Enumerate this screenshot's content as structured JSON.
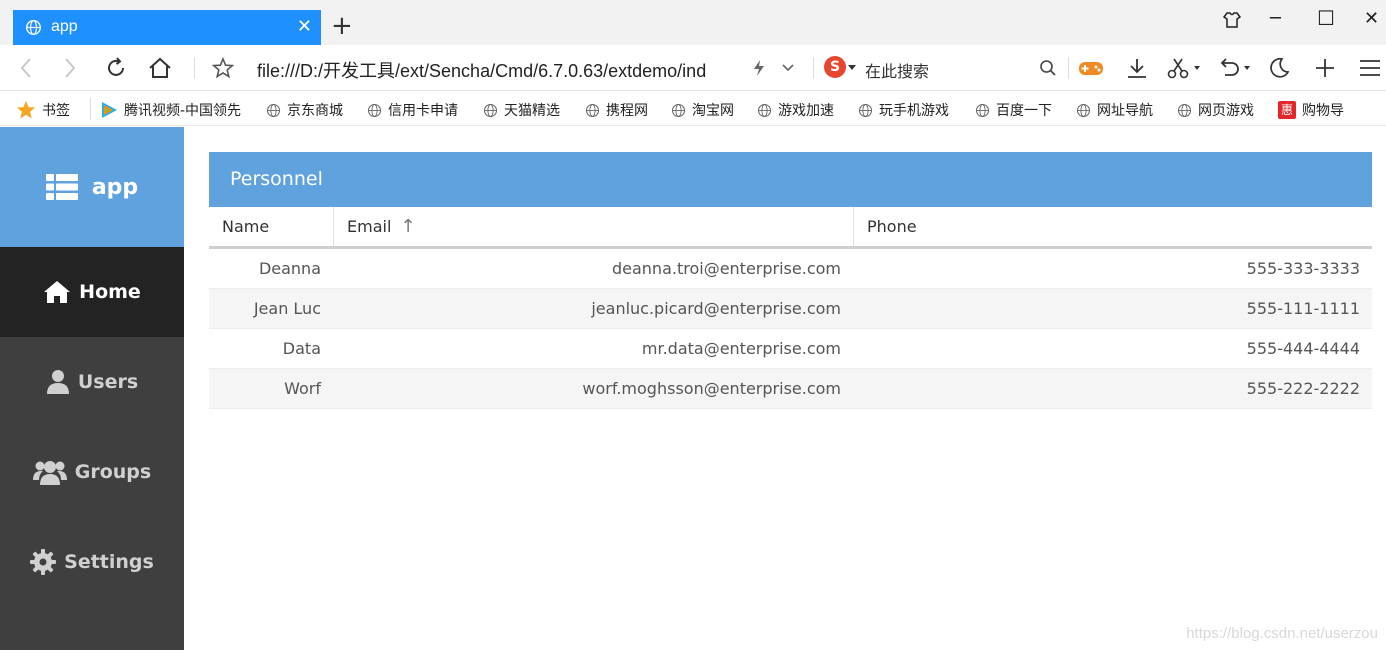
{
  "browser": {
    "tab": {
      "title": "app",
      "close_label": "✕"
    },
    "new_tab_label": "+",
    "window_controls": {
      "skin": "skin-icon",
      "minimize": "─",
      "maximize": "☐",
      "close": "✕"
    },
    "address": {
      "url": "file:///D:/开发工具/ext/Sencha/Cmd/6.7.0.63/extdemo/ind"
    },
    "search": {
      "placeholder": "在此搜索"
    },
    "bookmarks": [
      {
        "label": "书签",
        "icon": "star-icon"
      },
      {
        "label": "腾讯视频-中国领先",
        "icon": "tencent-video-icon"
      },
      {
        "label": "京东商城",
        "icon": "globe-icon"
      },
      {
        "label": "信用卡申请",
        "icon": "globe-icon"
      },
      {
        "label": "天猫精选",
        "icon": "globe-icon"
      },
      {
        "label": "携程网",
        "icon": "globe-icon"
      },
      {
        "label": "淘宝网",
        "icon": "globe-icon"
      },
      {
        "label": "游戏加速",
        "icon": "globe-icon"
      },
      {
        "label": "玩手机游戏",
        "icon": "globe-icon"
      },
      {
        "label": "百度一下",
        "icon": "globe-icon"
      },
      {
        "label": "网址导航",
        "icon": "globe-icon"
      },
      {
        "label": "网页游戏",
        "icon": "globe-icon"
      },
      {
        "label": "购物导",
        "icon": "hui-icon"
      }
    ]
  },
  "app": {
    "logo": {
      "label": "app"
    },
    "nav": [
      {
        "label": "Home",
        "icon": "home-icon",
        "active": true
      },
      {
        "label": "Users",
        "icon": "user-icon",
        "active": false
      },
      {
        "label": "Groups",
        "icon": "users-group-icon",
        "active": false
      },
      {
        "label": "Settings",
        "icon": "gear-icon",
        "active": false
      }
    ],
    "panel": {
      "title": "Personnel",
      "columns": [
        "Name",
        "Email",
        "Phone"
      ],
      "sort_indicator": "↑",
      "rows": [
        {
          "name": "Deanna",
          "email": "deanna.troi@enterprise.com",
          "phone": "555-333-3333"
        },
        {
          "name": "Jean Luc",
          "email": "jeanluc.picard@enterprise.com",
          "phone": "555-111-1111"
        },
        {
          "name": "Data",
          "email": "mr.data@enterprise.com",
          "phone": "555-444-4444"
        },
        {
          "name": "Worf",
          "email": "worf.moghsson@enterprise.com",
          "phone": "555-222-2222"
        }
      ]
    }
  },
  "watermark": "https://blog.csdn.net/userzou",
  "colors": {
    "tab_active": "#1e90ff",
    "accent_blue": "#5fa2dd",
    "sidebar": "#3f3f3f",
    "sidebar_active": "#232323"
  }
}
